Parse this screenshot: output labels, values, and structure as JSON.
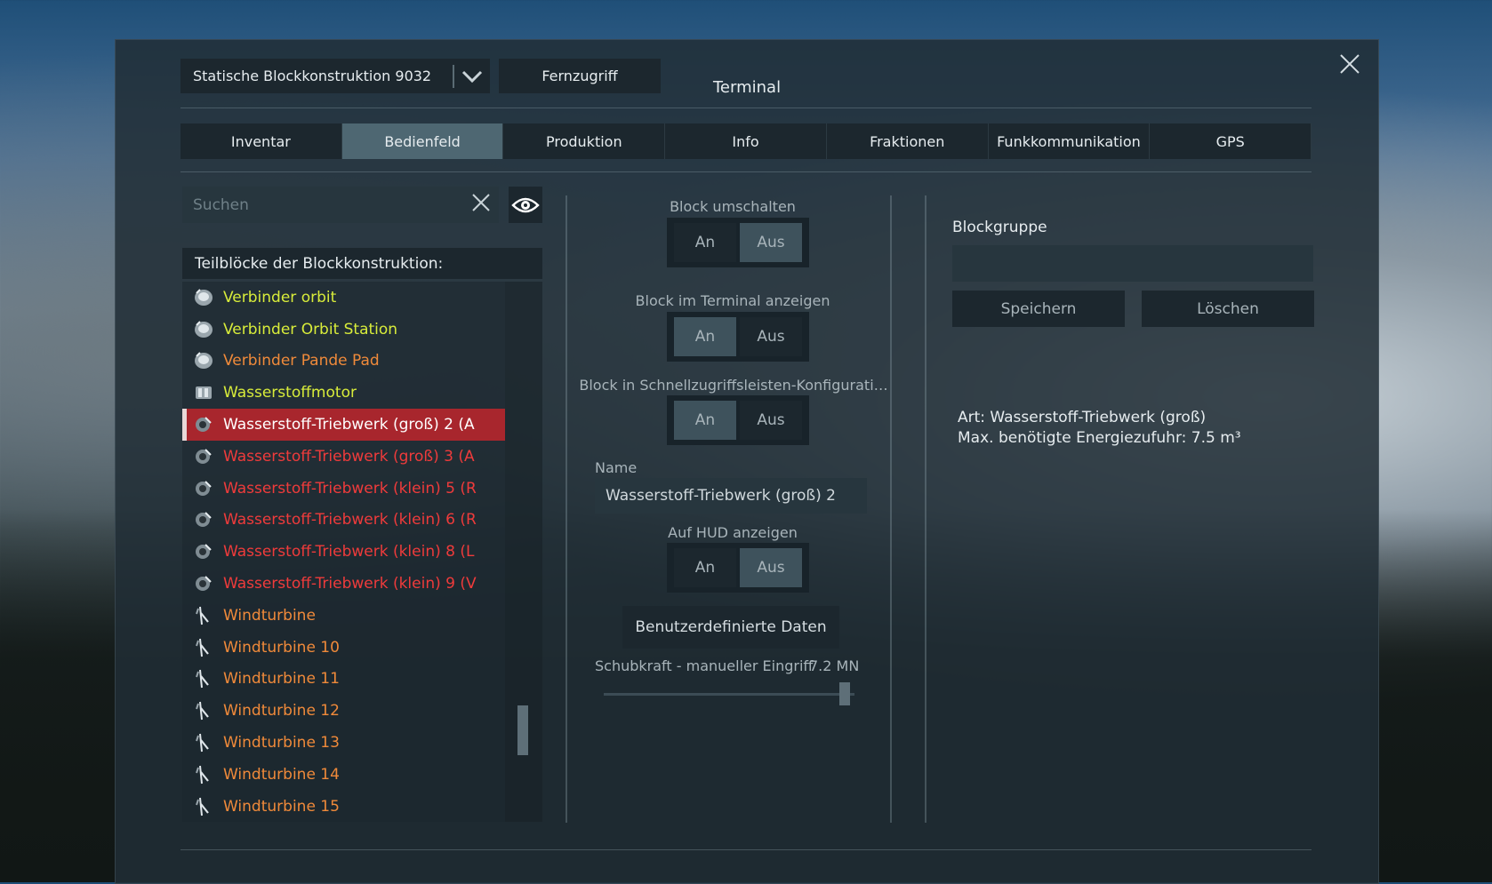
{
  "window": {
    "title": "Terminal",
    "grid_selector": "Statische Blockkonstruktion 9032",
    "remote_button": "Fernzugriff"
  },
  "tabs": [
    {
      "label": "Inventar",
      "active": false
    },
    {
      "label": "Bedienfeld",
      "active": true
    },
    {
      "label": "Produktion",
      "active": false
    },
    {
      "label": "Info",
      "active": false
    },
    {
      "label": "Fraktionen",
      "active": false
    },
    {
      "label": "Funkkommunikation",
      "active": false
    },
    {
      "label": "GPS",
      "active": false
    }
  ],
  "search": {
    "placeholder": "Suchen",
    "value": ""
  },
  "block_list": {
    "header": "Teilblöcke der Blockkonstruktion:",
    "items": [
      {
        "label": "Verbinder orbit",
        "color": "#d8ec3a",
        "icon": "connector-icon"
      },
      {
        "label": "Verbinder Orbit Station",
        "color": "#d8ec3a",
        "icon": "connector-icon"
      },
      {
        "label": "Verbinder Pande Pad",
        "color": "#f08a3a",
        "icon": "connector-icon"
      },
      {
        "label": "Wasserstoffmotor",
        "color": "#d8ec3a",
        "icon": "engine-icon"
      },
      {
        "label": "Wasserstoff-Triebwerk (groß) 2 (A",
        "color": "#ffffff",
        "icon": "thruster-icon",
        "selected": true
      },
      {
        "label": "Wasserstoff-Triebwerk (groß) 3 (A",
        "color": "#ef3b3b",
        "icon": "thruster-icon"
      },
      {
        "label": "Wasserstoff-Triebwerk (klein) 5 (R",
        "color": "#ef3b3b",
        "icon": "thruster-icon"
      },
      {
        "label": "Wasserstoff-Triebwerk (klein) 6 (R",
        "color": "#ef3b3b",
        "icon": "thruster-icon"
      },
      {
        "label": "Wasserstoff-Triebwerk (klein) 8 (L",
        "color": "#ef3b3b",
        "icon": "thruster-icon"
      },
      {
        "label": "Wasserstoff-Triebwerk (klein) 9 (V",
        "color": "#ef3b3b",
        "icon": "thruster-icon"
      },
      {
        "label": "Windturbine",
        "color": "#f08a3a",
        "icon": "wind-turbine-icon"
      },
      {
        "label": "Windturbine 10",
        "color": "#f08a3a",
        "icon": "wind-turbine-icon"
      },
      {
        "label": "Windturbine 11",
        "color": "#f08a3a",
        "icon": "wind-turbine-icon"
      },
      {
        "label": "Windturbine 12",
        "color": "#f08a3a",
        "icon": "wind-turbine-icon"
      },
      {
        "label": "Windturbine 13",
        "color": "#f08a3a",
        "icon": "wind-turbine-icon"
      },
      {
        "label": "Windturbine 14",
        "color": "#f08a3a",
        "icon": "wind-turbine-icon"
      },
      {
        "label": "Windturbine 15",
        "color": "#f08a3a",
        "icon": "wind-turbine-icon"
      }
    ]
  },
  "controls": {
    "block_toggle": {
      "label": "Block umschalten",
      "on": "An",
      "off": "Aus",
      "state": "off"
    },
    "show_in_terminal": {
      "label": "Block im Terminal anzeigen",
      "on": "An",
      "off": "Aus",
      "state": "on"
    },
    "show_in_toolbar": {
      "label": "Block in Schnellzugriffsleisten-Konfigurati…",
      "on": "An",
      "off": "Aus",
      "state": "on"
    },
    "name": {
      "label": "Name",
      "value": "Wasserstoff-Triebwerk (groß) 2"
    },
    "show_on_hud": {
      "label": "Auf HUD anzeigen",
      "on": "An",
      "off": "Aus",
      "state": "off"
    },
    "custom_data_button": "Benutzerdefinierte Daten",
    "thrust_override": {
      "label": "Schubkraft - manueller Eingriff",
      "value_text": "7.2 MN",
      "fraction": 0.96
    }
  },
  "block_group": {
    "label": "Blockgruppe",
    "value": "",
    "save_button": "Speichern",
    "delete_button": "Löschen"
  },
  "details": {
    "type_line": "Art: Wasserstoff-Triebwerk (groß)",
    "energy_line": "Max. benötigte Energiezufuhr: 7.5 m³"
  }
}
